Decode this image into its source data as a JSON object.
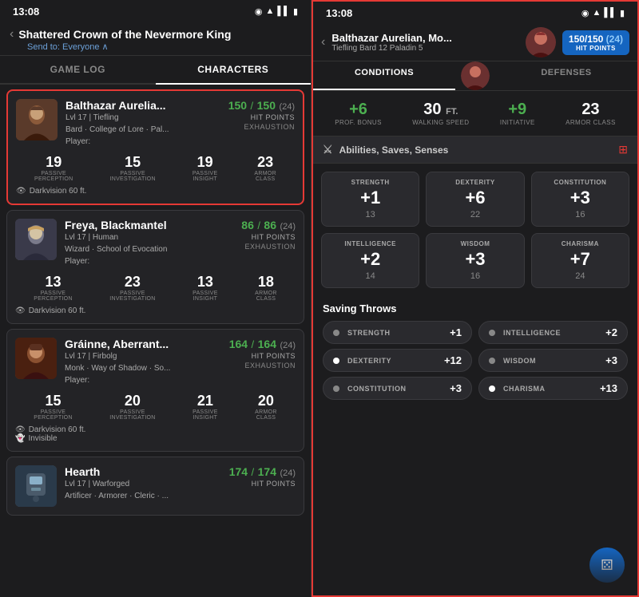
{
  "left": {
    "status_bar": {
      "time": "13:08",
      "icons": [
        "eye",
        "wifi",
        "signal",
        "battery"
      ]
    },
    "header": {
      "title": "Shattered Crown of the Nevermore King",
      "back_label": "‹",
      "send_to": "Send to: Everyone",
      "send_to_chevron": "∧"
    },
    "tabs": [
      {
        "id": "game-log",
        "label": "GAME LOG",
        "active": false
      },
      {
        "id": "characters",
        "label": "CHARACTERS",
        "active": true
      }
    ],
    "characters": [
      {
        "id": "balthazar",
        "name": "Balthazar Aurelia...",
        "level": "Lvl 17",
        "race": "Tiefling",
        "class1": "Bard · College of Lore · Pal...",
        "player": "Player:",
        "hp_current": "150",
        "hp_max": "150",
        "hp_extra": "(24)",
        "hp_label": "HIT POINTS",
        "exhaustion_label": "EXHAUSTION",
        "stats": [
          {
            "value": "19",
            "label": "PASSIVE\nPERCEPTION"
          },
          {
            "value": "15",
            "label": "PASSIVE\nINVESTIGATION"
          },
          {
            "value": "19",
            "label": "PASSIVE\nINSIGHT"
          },
          {
            "value": "23",
            "label": "ARMOR\nCLASS"
          }
        ],
        "darkvision": "Darkvision 60 ft.",
        "selected": true
      },
      {
        "id": "freya",
        "name": "Freya, Blackmantel",
        "level": "Lvl 17",
        "race": "Human",
        "class1": "Wizard · School of Evocation",
        "player": "Player:",
        "hp_current": "86",
        "hp_max": "86",
        "hp_extra": "(24)",
        "hp_label": "HIT POINTS",
        "exhaustion_label": "EXHAUSTION",
        "stats": [
          {
            "value": "13",
            "label": "PASSIVE\nPERCEPTION"
          },
          {
            "value": "23",
            "label": "PASSIVE\nINVESTIGATION"
          },
          {
            "value": "13",
            "label": "PASSIVE\nINSIGHT"
          },
          {
            "value": "18",
            "label": "ARMOR\nCLASS"
          }
        ],
        "darkvision": "Darkvision 60 ft.",
        "selected": false
      },
      {
        "id": "grainne",
        "name": "Gráinne, Aberrant...",
        "level": "Lvl 17",
        "race": "Firbolg",
        "class1": "Monk · Way of Shadow · So...",
        "player": "Player:",
        "hp_current": "164",
        "hp_max": "164",
        "hp_extra": "(24)",
        "hp_label": "HIT POINTS",
        "exhaustion_label": "EXHAUSTION",
        "stats": [
          {
            "value": "15",
            "label": "PASSIVE\nPERCEPTION"
          },
          {
            "value": "20",
            "label": "PASSIVE\nINVESTIGATION"
          },
          {
            "value": "21",
            "label": "PASSIVE\nINSIGHT"
          },
          {
            "value": "20",
            "label": "ARMOR\nCLASS"
          }
        ],
        "darkvision": "Darkvision 60 ft.",
        "invisible_label": "Invisible",
        "selected": false
      },
      {
        "id": "hearth",
        "name": "Hearth",
        "level": "Lvl 17",
        "race": "Warforged",
        "class1": "Artificer · Armorer · Cleric · ...",
        "player": "",
        "hp_current": "174",
        "hp_max": "174",
        "hp_extra": "(24)",
        "hp_label": "HIT POINTS",
        "selected": false
      }
    ]
  },
  "right": {
    "status_bar": {
      "time": "13:08"
    },
    "header": {
      "back_label": "‹",
      "char_name": "Balthazar Aurelian, Mo...",
      "char_class": "Tiefling Bard 12 Paladin 5",
      "hp_current": "150",
      "hp_max": "150",
      "hp_extra": "(24)",
      "hp_label": "HIT POINTS"
    },
    "tabs": [
      {
        "id": "conditions",
        "label": "CONDITIONS",
        "active": true
      },
      {
        "id": "avatar",
        "label": "",
        "is_avatar": true
      },
      {
        "id": "defenses",
        "label": "DEFENSES",
        "active": false
      }
    ],
    "quick_stats": [
      {
        "value": "+6",
        "label": "PROF. BONUS"
      },
      {
        "value": "30",
        "unit": "FT.",
        "label": "WALKING SPEED"
      },
      {
        "value": "+9",
        "label": "INITIATIVE"
      },
      {
        "value": "23",
        "label": "ARMOR CLASS"
      }
    ],
    "abilities_section": {
      "title": "Abilities, Saves, Senses",
      "abilities": [
        {
          "name": "STRENGTH",
          "modifier": "+1",
          "score": "13"
        },
        {
          "name": "DEXTERITY",
          "modifier": "+6",
          "score": "22"
        },
        {
          "name": "CONSTITUTION",
          "modifier": "+3",
          "score": "16"
        },
        {
          "name": "INTELLIGENCE",
          "modifier": "+2",
          "score": "14"
        },
        {
          "name": "WISDOM",
          "modifier": "+3",
          "score": "16"
        },
        {
          "name": "CHARISMA",
          "modifier": "+7",
          "score": "24"
        }
      ]
    },
    "saving_throws": {
      "title": "Saving Throws",
      "items": [
        {
          "label": "STRENGTH",
          "value": "+1",
          "proficient": false
        },
        {
          "label": "INTELLIGENCE",
          "value": "+2",
          "proficient": false
        },
        {
          "label": "DEXTERITY",
          "value": "+12",
          "proficient": true
        },
        {
          "label": "WISDOM",
          "value": "+3",
          "proficient": false
        },
        {
          "label": "CONSTITUTION",
          "value": "+3",
          "proficient": false
        },
        {
          "label": "CHARISMA",
          "value": "+13",
          "proficient": true
        }
      ]
    },
    "fab_icon": "⚄"
  }
}
